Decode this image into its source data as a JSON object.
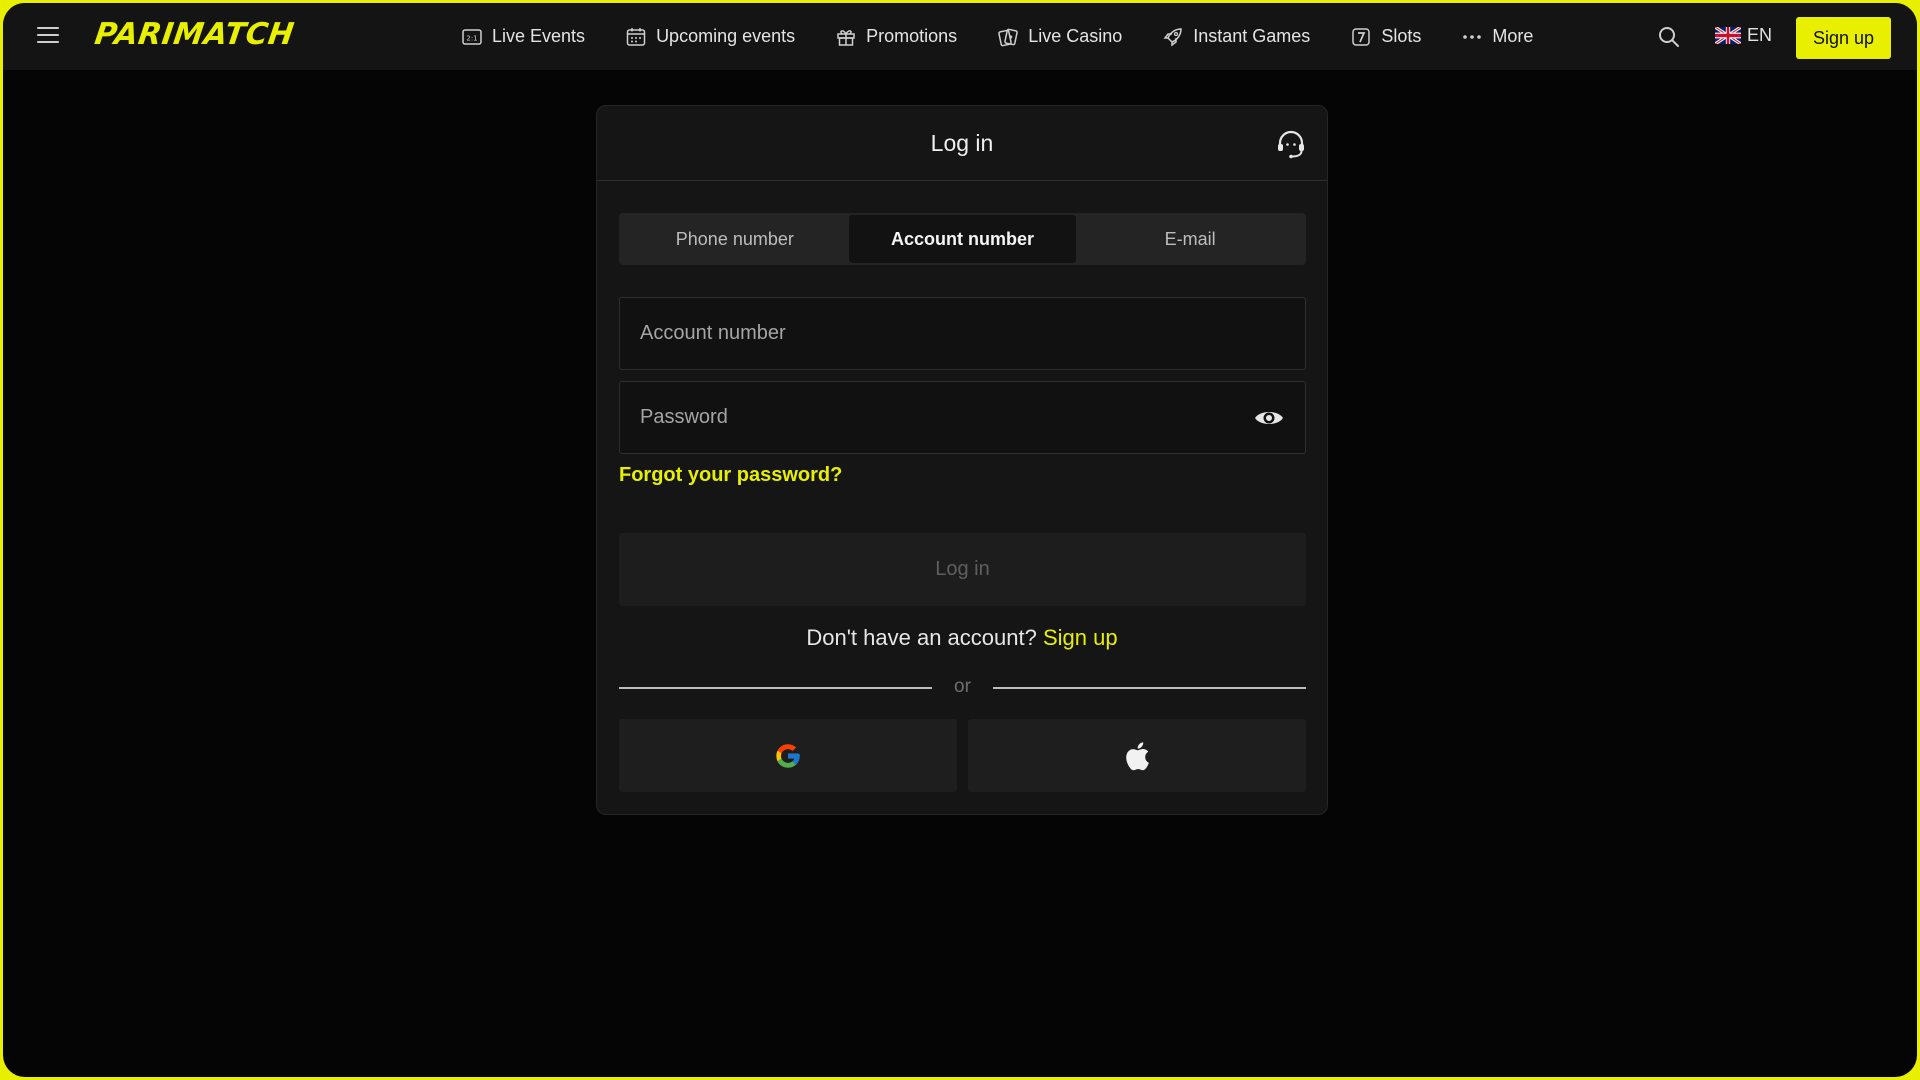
{
  "header": {
    "logo": "PARIMATCH",
    "nav": [
      {
        "label": "Live Events",
        "icon": "scoreboard-icon"
      },
      {
        "label": "Upcoming events",
        "icon": "calendar-icon"
      },
      {
        "label": "Promotions",
        "icon": "gift-icon"
      },
      {
        "label": "Live Casino",
        "icon": "cards-icon"
      },
      {
        "label": "Instant Games",
        "icon": "rocket-icon"
      },
      {
        "label": "Slots",
        "icon": "slot-seven-icon"
      },
      {
        "label": "More",
        "icon": "more-dots-icon"
      }
    ],
    "language": "EN",
    "signup_label": "Sign up"
  },
  "login": {
    "title": "Log in",
    "tabs": [
      {
        "label": "Phone number",
        "active": false
      },
      {
        "label": "Account number",
        "active": true
      },
      {
        "label": "E-mail",
        "active": false
      }
    ],
    "account_placeholder": "Account number",
    "password_placeholder": "Password",
    "forgot_label": "Forgot your password?",
    "submit_label": "Log in",
    "no_account_text": "Don't have an account?",
    "signup_link": "Sign up",
    "or_label": "or"
  },
  "colors": {
    "accent": "#e8f000",
    "background": "#050505",
    "panel": "#151515"
  }
}
